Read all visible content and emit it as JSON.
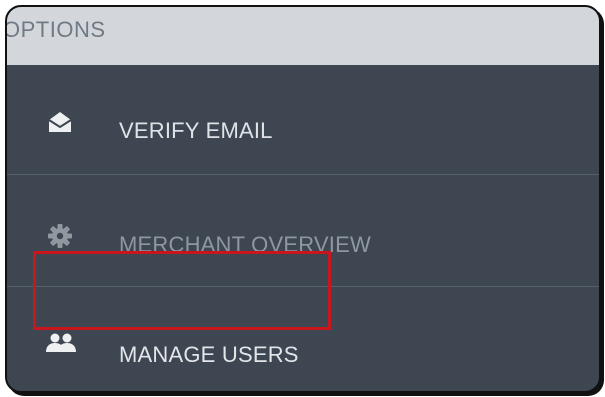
{
  "section": {
    "title": "OPTIONS"
  },
  "menu": {
    "items": [
      {
        "label": "VERIFY EMAIL",
        "icon": "envelope-open-icon"
      },
      {
        "label": "MERCHANT OVERVIEW",
        "icon": "gear-icon"
      },
      {
        "label": "MANAGE USERS",
        "icon": "users-icon"
      }
    ]
  },
  "colors": {
    "header_bg": "#d3d7dc",
    "panel_bg": "#3d4651",
    "highlight": "#c9161d"
  }
}
